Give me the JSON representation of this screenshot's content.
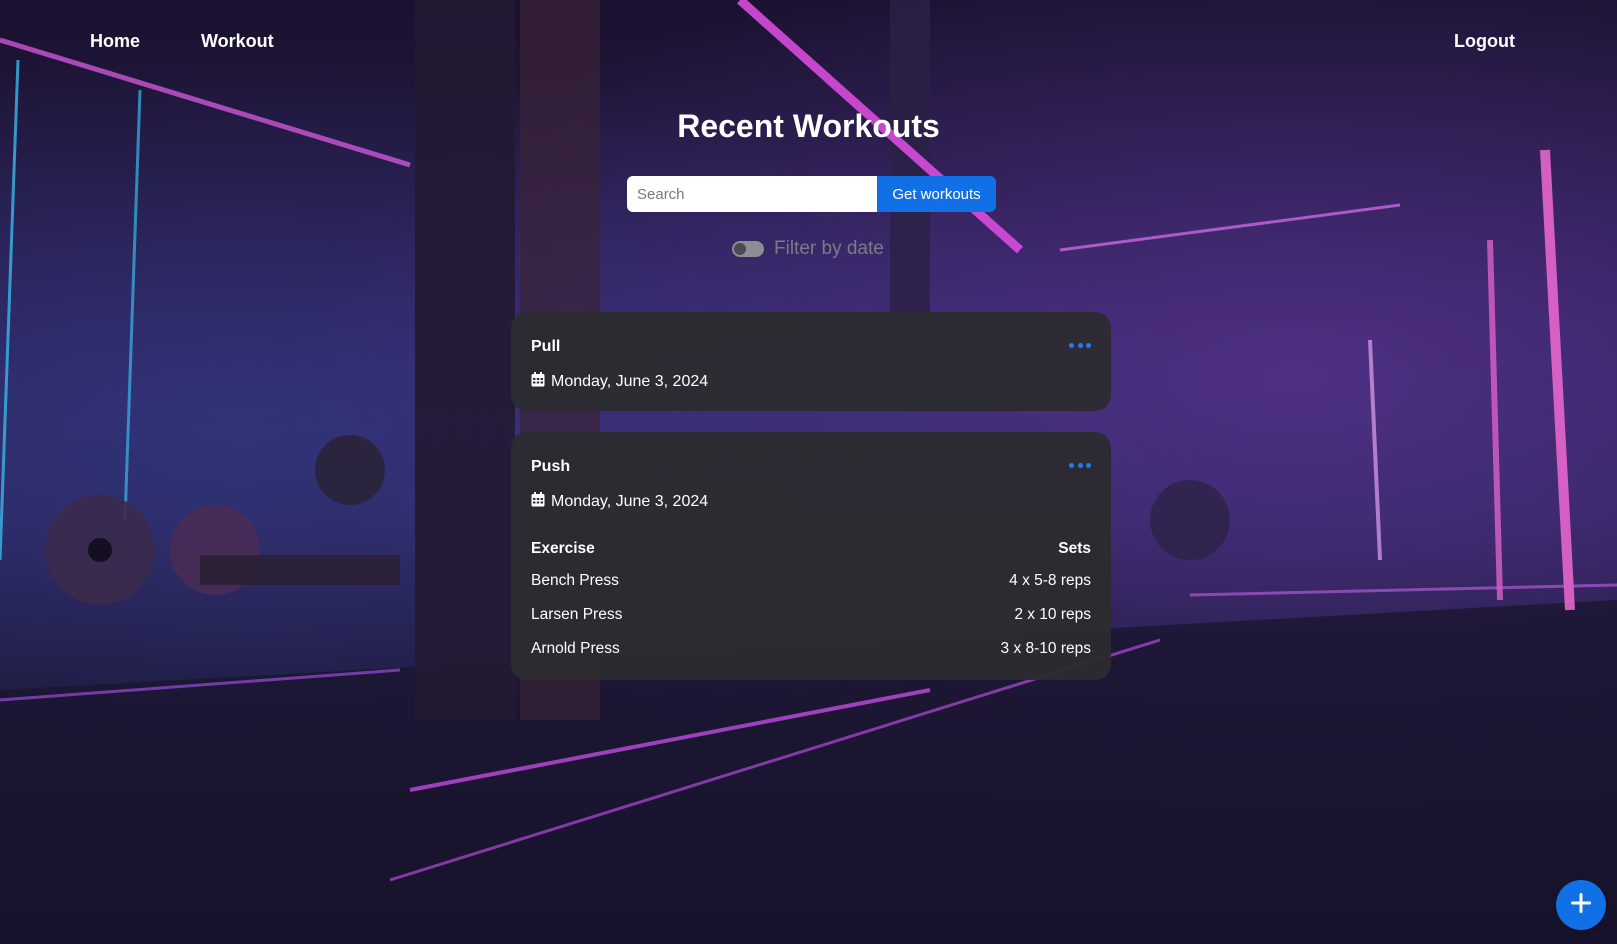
{
  "nav": {
    "home_label": "Home",
    "workout_label": "Workout",
    "logout_label": "Logout"
  },
  "header": {
    "title": "Recent Workouts",
    "search_placeholder": "Search",
    "search_value": "",
    "search_button_label": "Get workouts",
    "filter_label": "Filter by date",
    "filter_enabled": false
  },
  "workouts": [
    {
      "title": "Pull",
      "date": "Monday, June 3, 2024",
      "menu_icon": "more-horizontal-icon",
      "date_icon": "calendar-icon"
    },
    {
      "title": "Push",
      "date": "Monday, June 3, 2024",
      "menu_icon": "more-horizontal-icon",
      "date_icon": "calendar-icon",
      "table": {
        "headers": [
          "Exercise",
          "Sets"
        ],
        "rows": [
          {
            "exercise": "Bench Press",
            "sets": "4 x 5-8 reps"
          },
          {
            "exercise": "Larsen Press",
            "sets": "2 x 10 reps"
          },
          {
            "exercise": "Arnold Press",
            "sets": "3 x 8-10 reps"
          }
        ]
      }
    }
  ],
  "fab": {
    "icon": "plus-icon"
  },
  "colors": {
    "accent": "#1170e6",
    "card_bg": "#2c2c30",
    "menu_dots": "#1c7cf0"
  }
}
